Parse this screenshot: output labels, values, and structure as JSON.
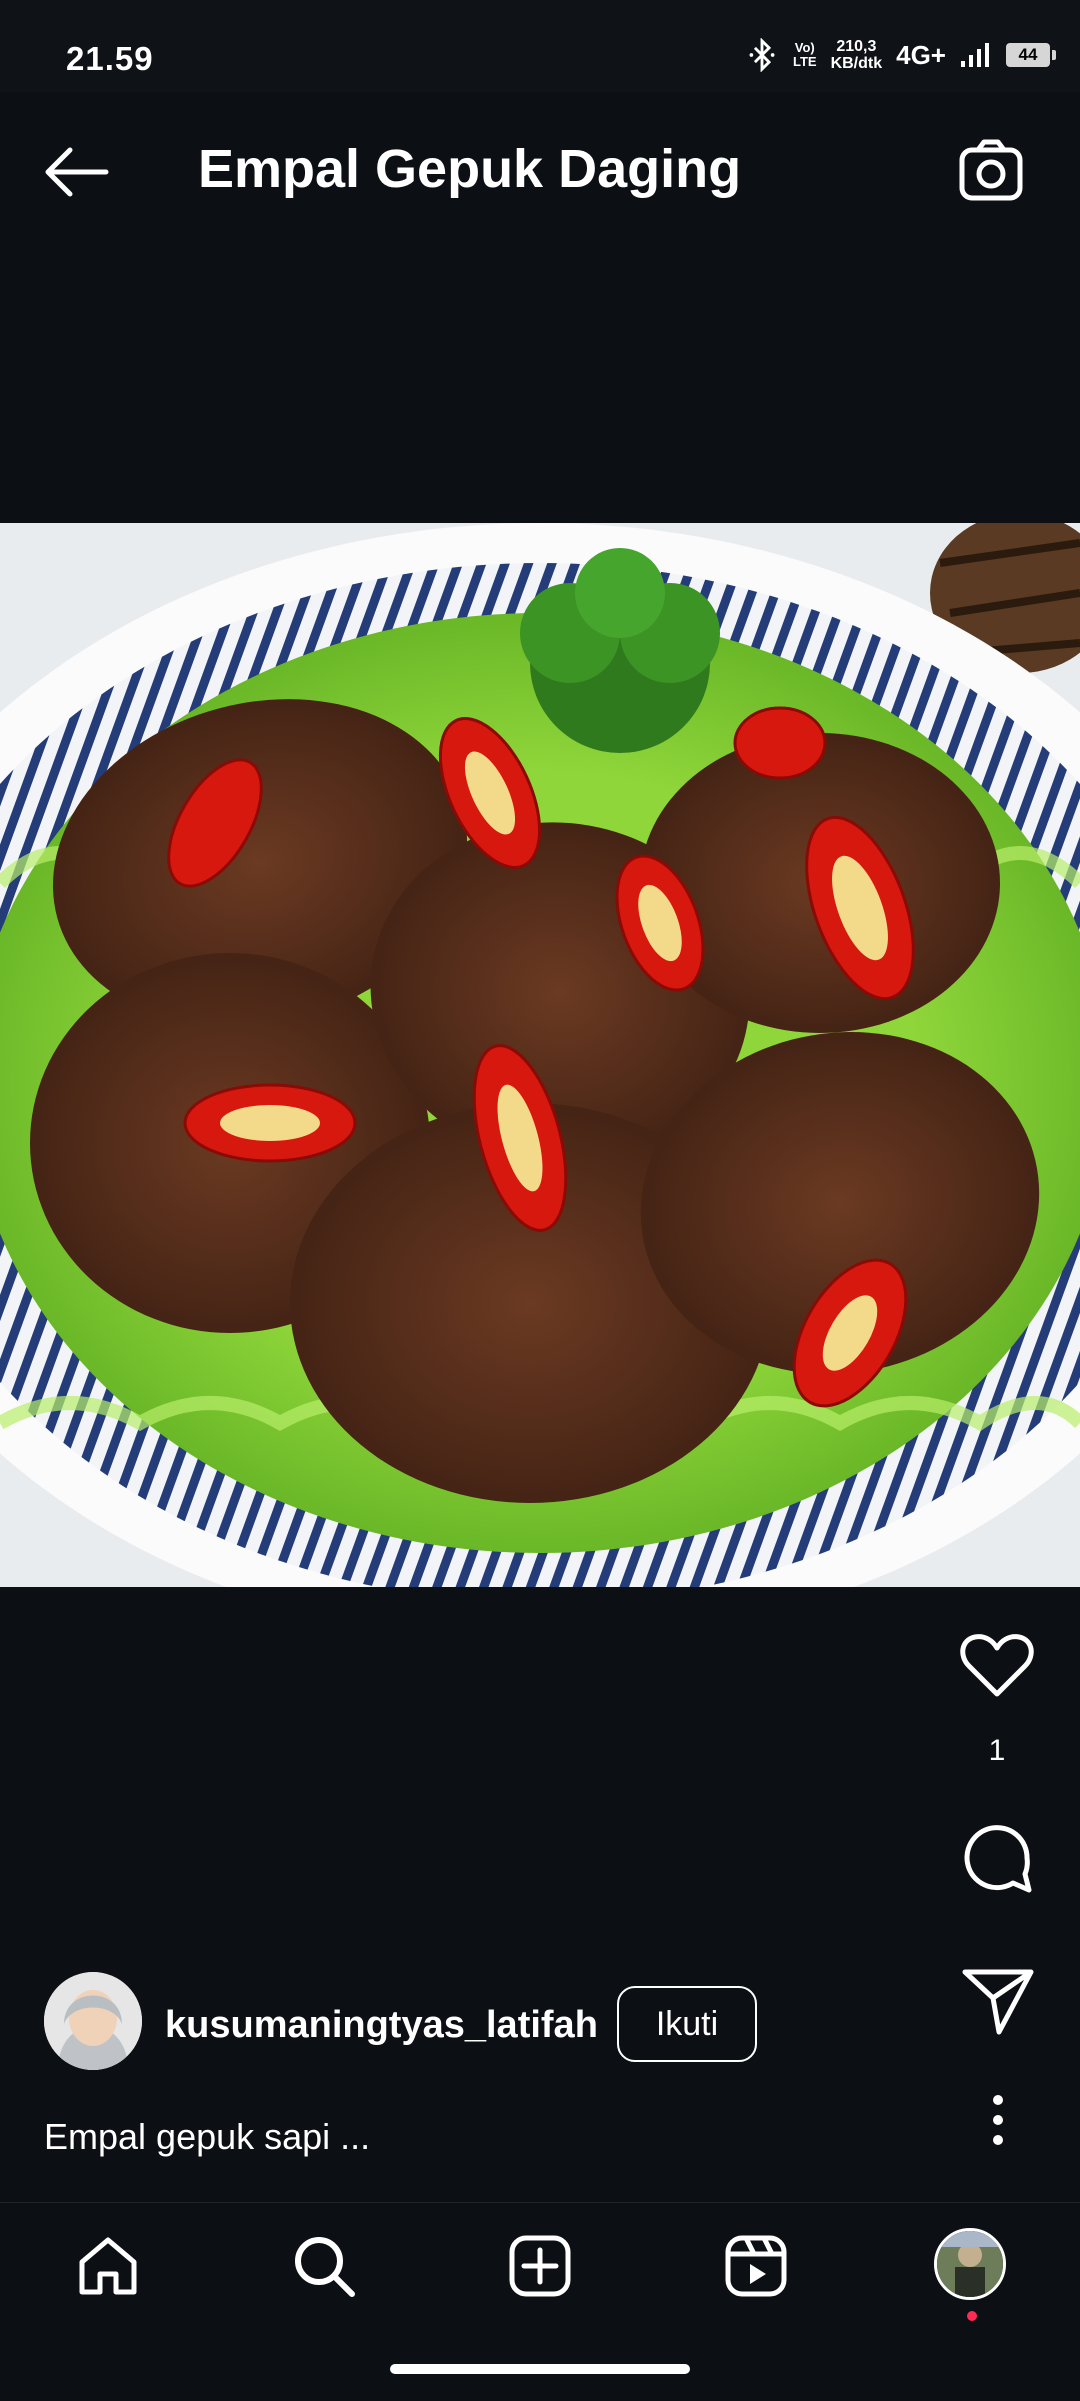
{
  "status_bar": {
    "time": "21.59",
    "volte_line1": "Vo)",
    "volte_line2": "LTE",
    "speed_value": "210,3",
    "speed_unit": "KB/dtk",
    "network": "4G+",
    "battery": "44",
    "icons": [
      "bluetooth-icon",
      "volte-icon",
      "signal-icon",
      "battery-icon"
    ]
  },
  "header": {
    "title": "Empal Gepuk Daging",
    "back_icon": "arrow-left-icon",
    "camera_icon": "camera-icon"
  },
  "post": {
    "likes": "1",
    "author": "kusumaningtyas_latifah",
    "follow_label": "Ikuti",
    "caption": "Empal gepuk sapi ...",
    "actions": [
      "heart-icon",
      "comment-icon",
      "send-icon",
      "more-vertical-icon"
    ]
  },
  "bottom_nav": {
    "items": [
      "home-icon",
      "search-icon",
      "create-icon",
      "reels-icon",
      "profile-avatar"
    ]
  },
  "colors": {
    "background": "#0c0f14",
    "text": "#ffffff",
    "notification_dot": "#ff2b55"
  }
}
